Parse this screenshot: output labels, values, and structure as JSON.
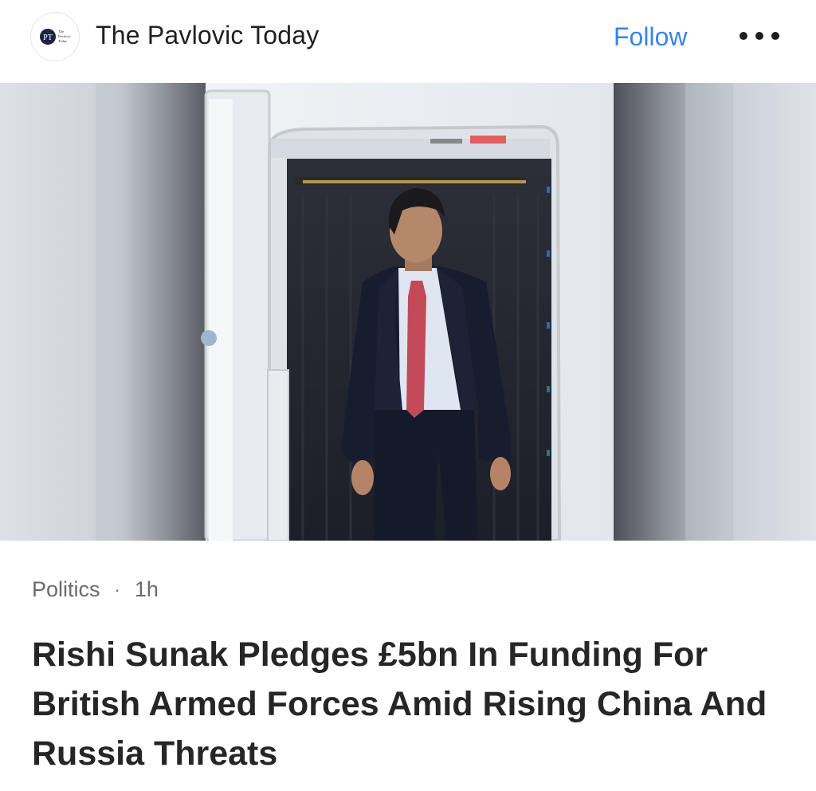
{
  "header": {
    "publisher_name": "The Pavlovic Today",
    "avatar_monogram": "PT",
    "avatar_wordmark": [
      "The",
      "Pavlovic",
      "Today"
    ],
    "follow_label": "Follow",
    "more_icon": "ellipsis-icon"
  },
  "hero_image": {
    "description_icon": "article-photo",
    "accent_colors": {
      "suit": "#14182a",
      "tie": "#c24a58",
      "shirt": "#dfe6f2",
      "aircraft": "#eef1f5"
    }
  },
  "article": {
    "category": "Politics",
    "separator": "·",
    "age": "1h",
    "headline": "Rishi Sunak Pledges £5bn In Funding For British Armed Forces Amid Rising China And Russia Threats"
  },
  "colors": {
    "accent": "#3b83e8",
    "text": "#1f1f1f",
    "muted": "#6b6b6b"
  }
}
